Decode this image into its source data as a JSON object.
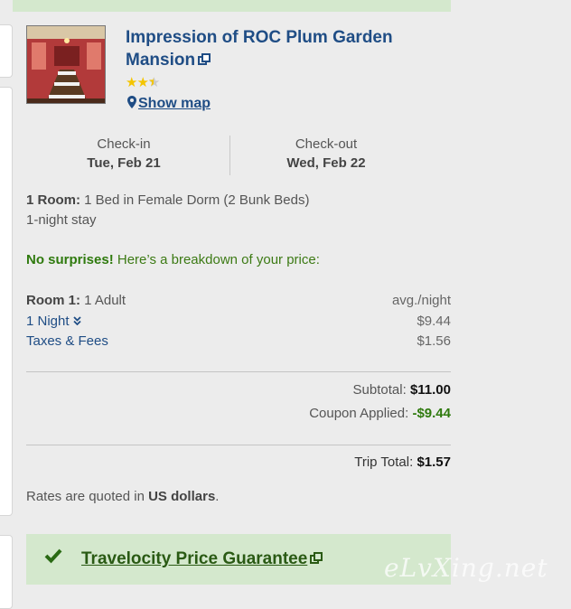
{
  "hotel": {
    "name": "Impression of ROC Plum Garden Mansion",
    "stars": 2.5,
    "show_map_label": "Show map"
  },
  "dates": {
    "checkin_label": "Check-in",
    "checkin_value": "Tue, Feb 21",
    "checkout_label": "Check-out",
    "checkout_value": "Wed, Feb 22"
  },
  "room": {
    "label": "1 Room:",
    "description": "1 Bed in Female Dorm (2 Bunk Beds)",
    "stay": "1-night stay"
  },
  "breakdown": {
    "headline_bold": "No surprises!",
    "headline_rest": "Here’s a breakdown of your price:",
    "room_label": "Room 1:",
    "room_guests": "1 Adult",
    "avg_label": "avg./night",
    "night_label": "1 Night",
    "night_price": "$9.44",
    "taxes_label": "Taxes & Fees",
    "taxes_price": "$1.56"
  },
  "totals": {
    "subtotal_label": "Subtotal:",
    "subtotal_value": "$11.00",
    "coupon_label": "Coupon Applied:",
    "coupon_value": "-$9.44",
    "trip_total_label": "Trip Total:",
    "trip_total_value": "$1.57"
  },
  "rates_note": {
    "prefix": "Rates are quoted in",
    "currency": "US dollars",
    "suffix": "."
  },
  "guarantee": {
    "label": "Travelocity Price Guarantee"
  },
  "watermark": "eLvXing.net",
  "colors": {
    "link_blue": "#1f4d85",
    "green_text": "#2f7a0e",
    "green_panel": "#d4e8cd",
    "star_gold": "#f4c500"
  }
}
